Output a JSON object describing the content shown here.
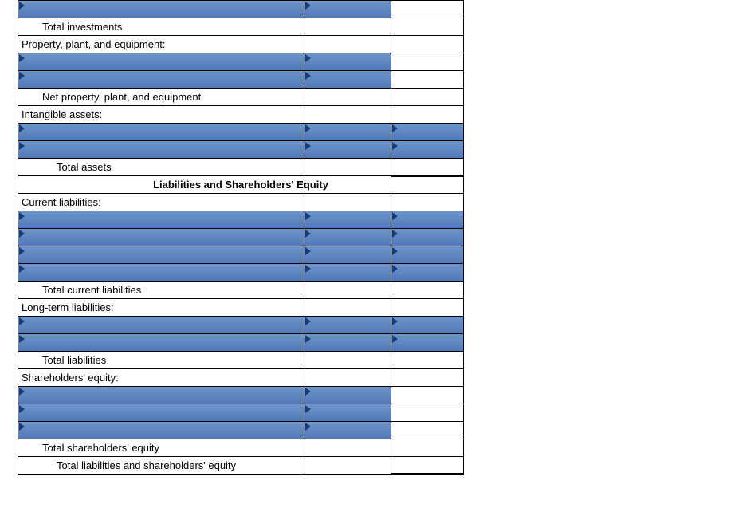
{
  "labels": {
    "total_investments": "Total investments",
    "ppe_header": "Property, plant, and equipment:",
    "net_ppe": "Net property, plant, and equipment",
    "intangible_header": "Intangible assets:",
    "total_assets": "Total assets",
    "section_liab_equity": "Liabilities and Shareholders' Equity",
    "current_liab_header": "Current liabilities:",
    "total_current_liab": "Total current liabilities",
    "longterm_liab_header": "Long-term liabilities:",
    "total_liabilities": "Total liabilities",
    "se_header": "Shareholders' equity:",
    "total_se": "Total shareholders' equity",
    "total_liab_se": "Total liabilities and shareholders' equity"
  }
}
